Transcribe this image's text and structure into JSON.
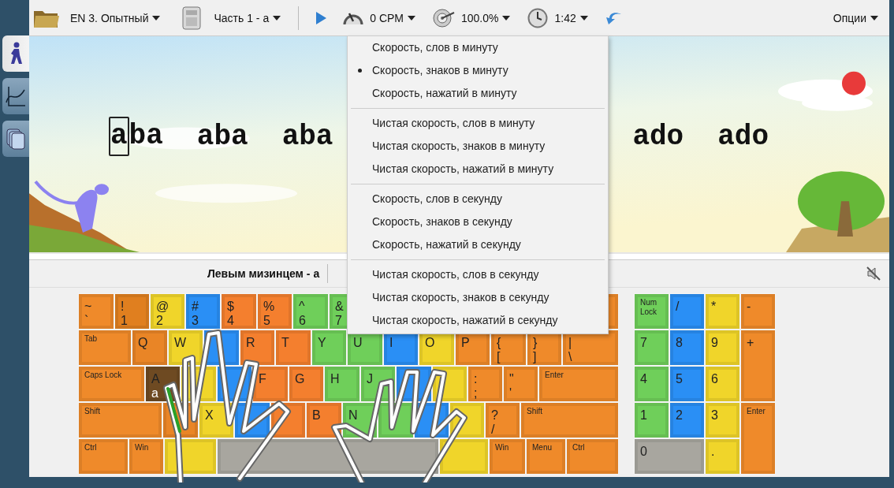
{
  "sidebar": {
    "tabs": [
      {
        "kind": "walk",
        "selected": true
      },
      {
        "kind": "chart",
        "selected": false
      },
      {
        "kind": "docs",
        "selected": false
      }
    ]
  },
  "toolbar": {
    "items": [
      {
        "kind": "course",
        "label": "EN 3. Опытный"
      },
      {
        "kind": "lesson",
        "label": "Часть 1 - a"
      },
      {
        "kind": "separator"
      },
      {
        "kind": "play"
      },
      {
        "kind": "speed",
        "label": "0 CPM"
      },
      {
        "kind": "accuracy",
        "label": "100.0%"
      },
      {
        "kind": "timer",
        "label": "1:42"
      },
      {
        "kind": "back"
      },
      {
        "kind": "options",
        "label": "Опции"
      }
    ]
  },
  "exercise": {
    "words_left": [
      {
        "text": "aba",
        "current": true
      },
      {
        "text": "aba",
        "current": false
      },
      {
        "text": "aba",
        "current": false
      }
    ],
    "words_right": [
      {
        "text": "ado",
        "current": false
      },
      {
        "text": "ado",
        "current": false
      }
    ]
  },
  "hint": "Левым мизинцем - a",
  "speed_menu": {
    "items": [
      {
        "kind": "item",
        "label": "Скорость, слов в минуту",
        "selected": false
      },
      {
        "kind": "item",
        "label": "Скорость, знаков в минуту",
        "selected": true
      },
      {
        "kind": "item",
        "label": "Скорость, нажатий в минуту",
        "selected": false
      },
      {
        "kind": "separator"
      },
      {
        "kind": "item",
        "label": "Чистая скорость, слов в минуту",
        "selected": false
      },
      {
        "kind": "item",
        "label": "Чистая скорость, знаков в минуту",
        "selected": false
      },
      {
        "kind": "item",
        "label": "Чистая скорость, нажатий в минуту",
        "selected": false
      },
      {
        "kind": "separator"
      },
      {
        "kind": "item",
        "label": "Скорость, слов в секунду",
        "selected": false
      },
      {
        "kind": "item",
        "label": "Скорость, знаков в секунду",
        "selected": false
      },
      {
        "kind": "item",
        "label": "Скорость, нажатий в секунду",
        "selected": false
      },
      {
        "kind": "separator"
      },
      {
        "kind": "item",
        "label": "Чистая скорость, слов в секунду",
        "selected": false
      },
      {
        "kind": "item",
        "label": "Чистая скорость, знаков в секунду",
        "selected": false
      },
      {
        "kind": "item",
        "label": "Чистая скорость, нажатий в секунду",
        "selected": false
      }
    ]
  },
  "keyboard": {
    "rows": [
      [
        {
          "kind": "char",
          "labels": [
            "~",
            "`"
          ],
          "color": "#ef8a2a"
        },
        {
          "kind": "char",
          "labels": [
            "!",
            "1"
          ],
          "color": "#e07f1f"
        },
        {
          "kind": "char",
          "labels": [
            "@",
            "2"
          ],
          "color": "#f0d52a"
        },
        {
          "kind": "char",
          "labels": [
            "#",
            "3"
          ],
          "color": "#2a8ff5"
        },
        {
          "kind": "char",
          "labels": [
            "$",
            "4"
          ],
          "color": "#f47f2e"
        },
        {
          "kind": "char",
          "labels": [
            "%",
            "5"
          ],
          "color": "#f47f2e"
        },
        {
          "kind": "char",
          "labels": [
            "^",
            "6"
          ],
          "color": "#6fcf5a"
        },
        {
          "kind": "char",
          "labels": [
            "&",
            "7"
          ],
          "color": "#6fcf5a"
        },
        {
          "kind": "char",
          "color": "#ef8a2a"
        }
      ],
      [
        {
          "kind": "mod",
          "labels": [
            "Tab"
          ],
          "color": "#ef8a2a"
        },
        {
          "kind": "char",
          "labels": [
            "Q"
          ],
          "color": "#e98526"
        },
        {
          "kind": "char",
          "labels": [
            "W"
          ],
          "color": "#f0d52a"
        },
        {
          "kind": "char",
          "color": "#2a8ff5"
        },
        {
          "kind": "char",
          "labels": [
            "R"
          ],
          "color": "#f47f2e"
        },
        {
          "kind": "char",
          "labels": [
            "T"
          ],
          "color": "#f47f2e"
        },
        {
          "kind": "char",
          "labels": [
            "Y"
          ],
          "color": "#6fcf5a"
        },
        {
          "kind": "char",
          "labels": [
            "U"
          ],
          "color": "#6fcf5a"
        },
        {
          "kind": "char",
          "labels": [
            "I"
          ],
          "color": "#2a8ff5"
        },
        {
          "kind": "char",
          "labels": [
            "O"
          ],
          "color": "#f0d52a"
        },
        {
          "kind": "char",
          "labels": [
            "P"
          ],
          "color": "#ef8a2a"
        },
        {
          "kind": "char",
          "labels": [
            "{",
            "["
          ],
          "color": "#ef8a2a"
        },
        {
          "kind": "char",
          "labels": [
            "}",
            "]"
          ],
          "color": "#ef8a2a"
        },
        {
          "kind": "char",
          "labels": [
            "|",
            "\\"
          ],
          "color": "#ef8a2a"
        }
      ],
      [
        {
          "kind": "mod",
          "labels": [
            "Caps Lock"
          ],
          "color": "#ef8a2a"
        },
        {
          "kind": "target",
          "labels": [
            "A",
            "a"
          ],
          "color": "#6e4a22"
        },
        {
          "kind": "char",
          "color": "#f0d52a"
        },
        {
          "kind": "char",
          "color": "#2a8ff5"
        },
        {
          "kind": "char",
          "labels": [
            "F"
          ],
          "color": "#f47f2e"
        },
        {
          "kind": "char",
          "labels": [
            "G"
          ],
          "color": "#f47f2e"
        },
        {
          "kind": "char",
          "labels": [
            "H"
          ],
          "color": "#6fcf5a"
        },
        {
          "kind": "char",
          "labels": [
            "J"
          ],
          "color": "#6fcf5a"
        },
        {
          "kind": "char",
          "color": "#2a8ff5"
        },
        {
          "kind": "char",
          "color": "#f0d52a"
        },
        {
          "kind": "char",
          "labels": [
            ":",
            ";"
          ],
          "color": "#ef8a2a"
        },
        {
          "kind": "char",
          "labels": [
            "\"",
            "'"
          ],
          "color": "#ef8a2a"
        },
        {
          "kind": "mod",
          "labels": [
            "Enter"
          ],
          "color": "#ef8a2a"
        }
      ],
      [
        {
          "kind": "mod",
          "labels": [
            "Shift"
          ],
          "color": "#ef8a2a"
        },
        {
          "kind": "char",
          "color": "#e98526"
        },
        {
          "kind": "char",
          "labels": [
            "X"
          ],
          "color": "#f0d52a"
        },
        {
          "kind": "char",
          "color": "#2a8ff5"
        },
        {
          "kind": "char",
          "color": "#f47f2e"
        },
        {
          "kind": "char",
          "labels": [
            "B"
          ],
          "color": "#f47f2e"
        },
        {
          "kind": "char",
          "labels": [
            "N"
          ],
          "color": "#6fcf5a"
        },
        {
          "kind": "char",
          "color": "#6fcf5a"
        },
        {
          "kind": "char",
          "color": "#2a8ff5"
        },
        {
          "kind": "char",
          "color": "#f0d52a"
        },
        {
          "kind": "char",
          "labels": [
            "?",
            "/"
          ],
          "color": "#ef8a2a"
        },
        {
          "kind": "mod",
          "labels": [
            "Shift"
          ],
          "color": "#ef8a2a"
        }
      ],
      [
        {
          "kind": "mod",
          "labels": [
            "Ctrl"
          ],
          "color": "#ef8a2a"
        },
        {
          "kind": "mod",
          "labels": [
            "Win"
          ],
          "color": "#ef8a2a"
        },
        {
          "kind": "mod",
          "color": "#f0d52a"
        },
        {
          "kind": "mod",
          "color": "#a8a69f"
        },
        {
          "kind": "mod",
          "color": "#f0d52a"
        },
        {
          "kind": "mod",
          "labels": [
            "Win"
          ],
          "color": "#ef8a2a"
        },
        {
          "kind": "mod",
          "labels": [
            "Menu"
          ],
          "color": "#ef8a2a"
        },
        {
          "kind": "mod",
          "labels": [
            "Ctrl"
          ],
          "color": "#ef8a2a"
        }
      ]
    ],
    "numpad": [
      {
        "kind": "mod",
        "labels": [
          "Num Lock"
        ],
        "color": "#6fcf5a"
      },
      {
        "kind": "char",
        "labels": [
          "/"
        ],
        "color": "#2a8ff5"
      },
      {
        "kind": "char",
        "labels": [
          "*"
        ],
        "color": "#f0d52a"
      },
      {
        "kind": "char",
        "labels": [
          "-"
        ],
        "color": "#ef8a2a"
      },
      {
        "kind": "char",
        "labels": [
          "7"
        ],
        "color": "#6fcf5a"
      },
      {
        "kind": "char",
        "labels": [
          "8"
        ],
        "color": "#2a8ff5"
      },
      {
        "kind": "char",
        "labels": [
          "9"
        ],
        "color": "#f0d52a"
      },
      {
        "kind": "char",
        "labels": [
          "+"
        ],
        "color": "#ef8a2a"
      },
      {
        "kind": "char",
        "labels": [
          "4"
        ],
        "color": "#6fcf5a"
      },
      {
        "kind": "char",
        "labels": [
          "5"
        ],
        "color": "#2a8ff5"
      },
      {
        "kind": "char",
        "labels": [
          "6"
        ],
        "color": "#f0d52a"
      },
      {
        "kind": "char",
        "labels": [
          "1"
        ],
        "color": "#6fcf5a"
      },
      {
        "kind": "char",
        "labels": [
          "2"
        ],
        "color": "#2a8ff5"
      },
      {
        "kind": "char",
        "labels": [
          "3"
        ],
        "color": "#f0d52a"
      },
      {
        "kind": "mod",
        "labels": [
          "Enter"
        ],
        "color": "#ef8a2a"
      },
      {
        "kind": "char",
        "labels": [
          "0"
        ],
        "color": "#a8a69f"
      },
      {
        "kind": "char",
        "labels": [
          "."
        ],
        "color": "#f0d52a"
      }
    ]
  }
}
